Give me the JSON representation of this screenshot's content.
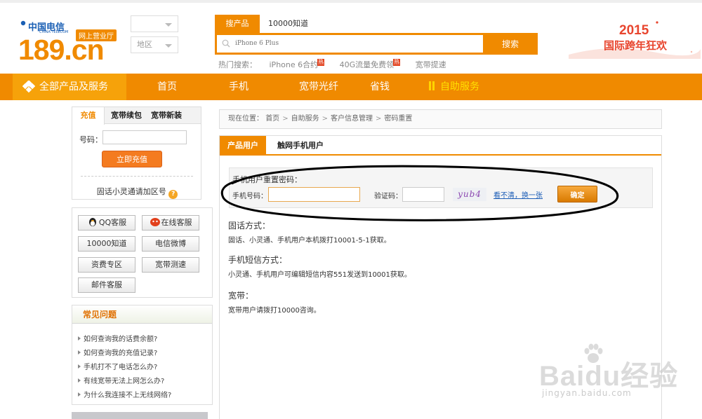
{
  "header": {
    "brand_cn": "中国电信",
    "brand_en": "CHINA TELECOM",
    "ehall": "网上营业厅",
    "domain": "189.cn",
    "region_label": "地区",
    "search_tab_active": "搜产品",
    "search_tab_other": "10000知道",
    "search_placeholder": "iPhone 6 Plus",
    "search_button": "搜索",
    "hot_label": "热门搜索：",
    "hot_links": [
      "iPhone 6合约",
      "40G流量免费领",
      "宽带提速"
    ],
    "hot_badge": "热",
    "promo_year": "2015",
    "promo_title": "国际跨年狂欢"
  },
  "nav": {
    "all": "全部产品及服务",
    "items": [
      "首页",
      "手机",
      "宽带光纤",
      "省钱",
      "自助服务"
    ]
  },
  "recharge": {
    "tabs": [
      "充值",
      "宽带续包",
      "宽带新装"
    ],
    "number_label": "号码：",
    "button": "立即充值",
    "note": "固话小灵通请加区号"
  },
  "services": [
    "QQ客服",
    "在线客服",
    "10000知道",
    "电信微博",
    "资费专区",
    "宽带测速",
    "邮件客服"
  ],
  "faq": {
    "title": "常见问题",
    "items": [
      "如何查询我的话费余额?",
      "如何查询我的充值记录?",
      "手机打不了电话怎么办?",
      "有线宽带无法上网怎么办?",
      "为什么我连接不上无线网络?"
    ]
  },
  "breadcrumb": {
    "prefix": "现在位置：",
    "items": [
      "首页",
      "自助服务",
      "客户信息管理",
      "密码重置"
    ],
    "sep": ">"
  },
  "main": {
    "tabs": [
      "产品用户",
      "触网手机用户"
    ],
    "form_title": "手机用户重置密码：",
    "phone_label": "手机号码：",
    "code_label": "验证码：",
    "captcha": "yub4",
    "refresh": "看不清，换一张",
    "ok": "确定",
    "sections": [
      {
        "title": "固话方式：",
        "text": "固话、小灵通、手机用户本机拨打10001-5-1获取。"
      },
      {
        "title": "手机短信方式：",
        "text": "小灵通、手机用户可编辑短信内容551发送到10001获取。"
      },
      {
        "title": "宽带：",
        "text": "宽带用户请拨打10000咨询。"
      }
    ]
  },
  "watermark": {
    "brand": "Baidu经验",
    "url": "jingyan.baidu.com"
  },
  "colors": {
    "accent": "#f08a00",
    "promo": "#e8452e",
    "link": "#1d5eb7"
  }
}
